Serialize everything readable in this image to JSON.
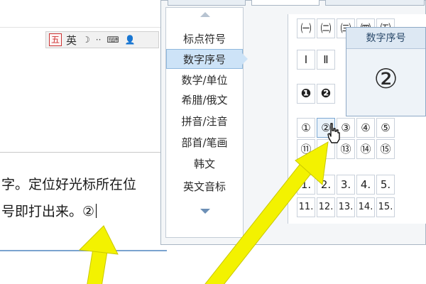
{
  "document": {
    "line_1": "字。定位好光标所在位",
    "line_2": "号即打出来。②"
  },
  "ime_toolbar": {
    "logo": "五",
    "mode_label": "英",
    "moon_icon": "moon-icon",
    "dots_icon": "dots-icon",
    "keyboard_icon": "keyboard-icon",
    "user_icon": "user-icon"
  },
  "categories": [
    {
      "label": "标点符号",
      "selected": false
    },
    {
      "label": "数字序号",
      "selected": true
    },
    {
      "label": "数学/单位",
      "selected": false
    },
    {
      "label": "希腊/俄文",
      "selected": false
    },
    {
      "label": "拼音/注音",
      "selected": false
    },
    {
      "label": "部首/笔画",
      "selected": false
    },
    {
      "label": "韩文",
      "selected": false
    },
    {
      "label": "英文音标",
      "selected": false
    }
  ],
  "symbol_rows": [
    [
      "㈠",
      "㈡",
      "㈢",
      "㈣",
      "㈤"
    ],
    [
      "Ⅰ",
      "Ⅱ",
      "",
      "",
      ""
    ],
    [
      "❶",
      "❷",
      "",
      "",
      ""
    ],
    [
      "①",
      "②",
      "③",
      "④",
      "⑤"
    ],
    [
      "⑪",
      "",
      "⑬",
      "⑭",
      "⑮"
    ],
    [
      "1.",
      "2.",
      "3.",
      "4.",
      "5."
    ],
    [
      "11.",
      "12.",
      "13.",
      "14.",
      "15."
    ]
  ],
  "preview": {
    "title": "数字序号",
    "glyph": "②"
  },
  "colors": {
    "selected_bg": "#cde3f7",
    "arrow_yellow": "#f3f200",
    "panel_border": "#a9b6c4"
  }
}
